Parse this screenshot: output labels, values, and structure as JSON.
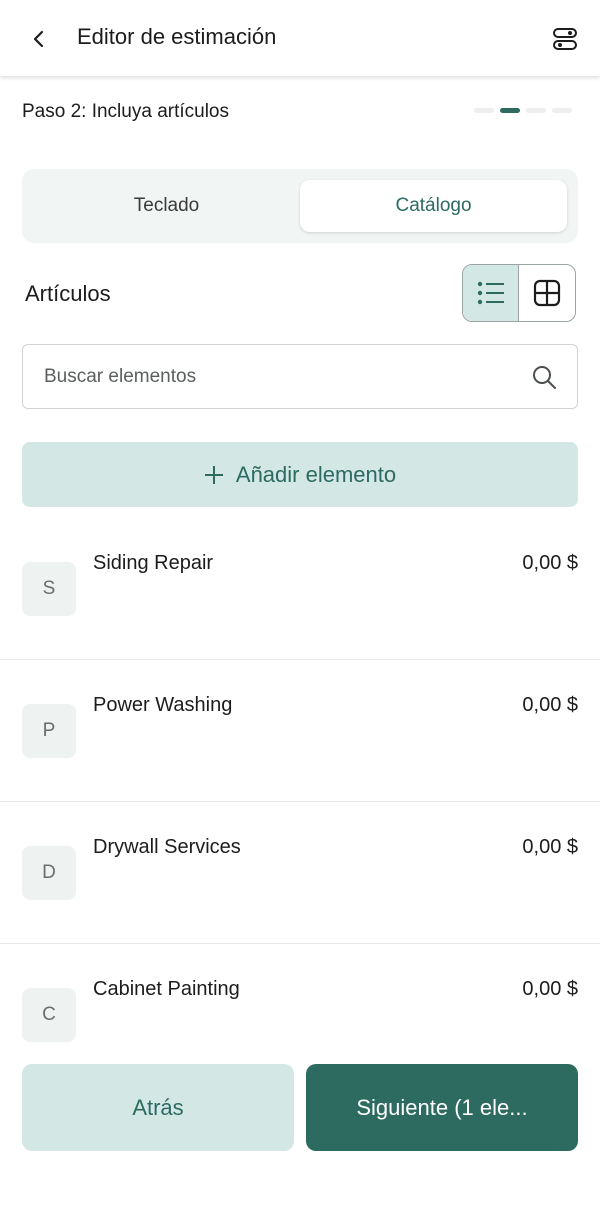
{
  "header": {
    "title": "Editor de estimación",
    "back_icon": "chevron-left-icon",
    "settings_icon": "sliders-icon"
  },
  "step": {
    "label": "Paso 2: Incluya artículos",
    "total": 4,
    "current": 2
  },
  "tabs": [
    {
      "label": "Teclado",
      "selected": false
    },
    {
      "label": "Catálogo",
      "selected": true
    }
  ],
  "section": {
    "title": "Artículos",
    "view_mode": "list"
  },
  "search": {
    "placeholder": "Buscar elementos",
    "value": ""
  },
  "add_button": {
    "label": "Añadir elemento"
  },
  "items": [
    {
      "initial": "S",
      "name": "Siding Repair",
      "price": "0,00 $"
    },
    {
      "initial": "P",
      "name": "Power Washing",
      "price": "0,00 $"
    },
    {
      "initial": "D",
      "name": "Drywall Services",
      "price": "0,00 $"
    },
    {
      "initial": "C",
      "name": "Cabinet Painting",
      "price": "0,00 $"
    }
  ],
  "footer": {
    "back_label": "Atrás",
    "next_label": "Siguiente (1 ele..."
  },
  "colors": {
    "accent": "#2d6b61",
    "accent_light": "#d3e7e5"
  }
}
